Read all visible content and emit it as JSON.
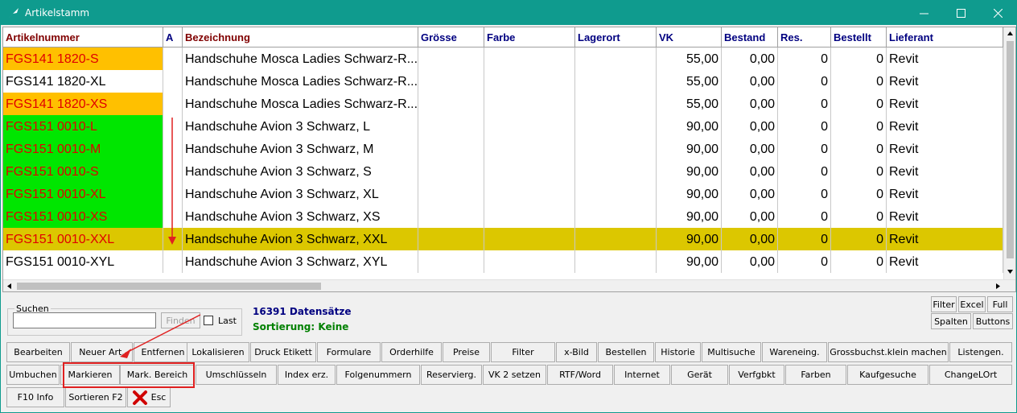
{
  "window": {
    "title": "Artikelstamm",
    "colors": {
      "titlebar": "#0f9b8e",
      "orange": "#ffc000",
      "green": "#00e600",
      "selected": "#dcc700",
      "red_text": "#e00000",
      "header_red": "#800000",
      "header_blue": "#000080",
      "annotation": "#e02020"
    }
  },
  "columns": [
    {
      "key": "art",
      "label": "Artikelnummer",
      "color": "#800000"
    },
    {
      "key": "a",
      "label": "A",
      "color": "#000080"
    },
    {
      "key": "bez",
      "label": "Bezeichnung",
      "color": "#800000"
    },
    {
      "key": "groesse",
      "label": "Grösse",
      "color": "#000080"
    },
    {
      "key": "farbe",
      "label": "Farbe",
      "color": "#000080"
    },
    {
      "key": "lagerort",
      "label": "Lagerort",
      "color": "#000080"
    },
    {
      "key": "vk",
      "label": "VK",
      "color": "#000080"
    },
    {
      "key": "bestand",
      "label": "Bestand",
      "color": "#000080"
    },
    {
      "key": "res",
      "label": "Res.",
      "color": "#000080"
    },
    {
      "key": "bestellt",
      "label": "Bestellt",
      "color": "#000080"
    },
    {
      "key": "lieferant",
      "label": "Lieferant",
      "color": "#000080"
    }
  ],
  "rows": [
    {
      "art": "FGS141 1820-S",
      "bez": "Handschuhe Mosca Ladies Schwarz-R...",
      "vk": "55,00",
      "bestand": "0,00",
      "res": "0",
      "bestellt": "0",
      "lieferant": "Revit",
      "highlight": "orange"
    },
    {
      "art": "FGS141 1820-XL",
      "bez": "Handschuhe Mosca Ladies Schwarz-R...",
      "vk": "55,00",
      "bestand": "0,00",
      "res": "0",
      "bestellt": "0",
      "lieferant": "Revit",
      "highlight": "none"
    },
    {
      "art": "FGS141 1820-XS",
      "bez": "Handschuhe Mosca Ladies Schwarz-R...",
      "vk": "55,00",
      "bestand": "0,00",
      "res": "0",
      "bestellt": "0",
      "lieferant": "Revit",
      "highlight": "orange"
    },
    {
      "art": "FGS151 0010-L",
      "bez": "Handschuhe Avion 3 Schwarz, L",
      "vk": "90,00",
      "bestand": "0,00",
      "res": "0",
      "bestellt": "0",
      "lieferant": "Revit",
      "highlight": "green"
    },
    {
      "art": "FGS151 0010-M",
      "bez": "Handschuhe Avion 3 Schwarz, M",
      "vk": "90,00",
      "bestand": "0,00",
      "res": "0",
      "bestellt": "0",
      "lieferant": "Revit",
      "highlight": "green"
    },
    {
      "art": "FGS151 0010-S",
      "bez": "Handschuhe Avion 3 Schwarz, S",
      "vk": "90,00",
      "bestand": "0,00",
      "res": "0",
      "bestellt": "0",
      "lieferant": "Revit",
      "highlight": "green"
    },
    {
      "art": "FGS151 0010-XL",
      "bez": "Handschuhe Avion 3 Schwarz, XL",
      "vk": "90,00",
      "bestand": "0,00",
      "res": "0",
      "bestellt": "0",
      "lieferant": "Revit",
      "highlight": "green"
    },
    {
      "art": "FGS151 0010-XS",
      "bez": "Handschuhe Avion 3 Schwarz, XS",
      "vk": "90,00",
      "bestand": "0,00",
      "res": "0",
      "bestellt": "0",
      "lieferant": "Revit",
      "highlight": "green"
    },
    {
      "art": "FGS151 0010-XXL",
      "bez": "Handschuhe Avion 3 Schwarz, XXL",
      "vk": "90,00",
      "bestand": "0,00",
      "res": "0",
      "bestellt": "0",
      "lieferant": "Revit",
      "highlight": "selected"
    },
    {
      "art": "FGS151 0010-XYL",
      "bez": "Handschuhe Avion 3 Schwarz, XYL",
      "vk": "90,00",
      "bestand": "0,00",
      "res": "0",
      "bestellt": "0",
      "lieferant": "Revit",
      "highlight": "none"
    }
  ],
  "search": {
    "group_label": "Suchen",
    "input_value": "",
    "find_button": "Finden",
    "last_label": "Last"
  },
  "status": {
    "records": "16391 Datensätze",
    "sorting": "Sortierung: Keine"
  },
  "topright": [
    "Filter",
    "Excel",
    "Full",
    "Spalten",
    "Buttons"
  ],
  "buttons_row1": [
    "Bearbeiten",
    "Neuer Art.",
    "Entfernen",
    "Lokalisieren",
    "Druck Etikett",
    "Formulare",
    "Orderhilfe",
    "Preise",
    "Filter",
    "x-Bild",
    "Bestellen",
    "Historie",
    "Multisuche",
    "Wareneing.",
    "Grossbuchst.klein machen",
    "Listengen."
  ],
  "buttons_row2": [
    "Umbuchen",
    "Markieren",
    "Mark. Bereich",
    "Umschlüsseln",
    "Index erz.",
    "Folgenummern",
    "Reservierg.",
    "VK 2 setzen",
    "RTF/Word",
    "Internet",
    "Gerät",
    "Verfgbkt",
    "Farben",
    "Kaufgesuche",
    "ChangeLOrt"
  ],
  "buttons_row3": [
    "F10 Info",
    "Sortieren F2",
    "Esc"
  ]
}
